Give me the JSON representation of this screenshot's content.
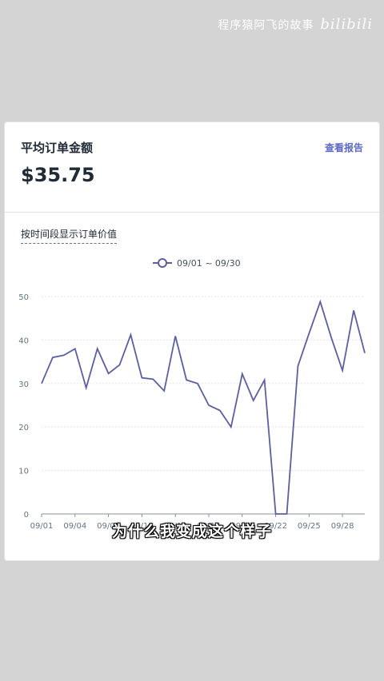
{
  "watermark": {
    "text": "程序猿阿飞的故事",
    "logo": "bilibili"
  },
  "card": {
    "title": "平均订单金额",
    "view_report": "查看报告",
    "amount": "$35.75",
    "subtitle": "按时间段显示订单价值"
  },
  "caption": "为什么我变成这个样子",
  "colors": {
    "line": "#5c5f9e",
    "accent": "#5c6ac4",
    "grid": "#dfe3e8"
  },
  "chart_data": {
    "type": "line",
    "legend": "09/01 ~ 09/30",
    "legend_position": "top-center",
    "grid": true,
    "ylim": [
      0,
      50
    ],
    "yticks": [
      0,
      10,
      20,
      30,
      40,
      50
    ],
    "xtick_labels": [
      "09/01",
      "09/04",
      "09/07",
      "09/10",
      "09/13",
      "09/16",
      "09/19",
      "09/22",
      "09/25",
      "09/28"
    ],
    "x": [
      "09/01",
      "09/02",
      "09/03",
      "09/04",
      "09/05",
      "09/06",
      "09/07",
      "09/08",
      "09/09",
      "09/10",
      "09/11",
      "09/12",
      "09/13",
      "09/14",
      "09/15",
      "09/16",
      "09/17",
      "09/18",
      "09/19",
      "09/20",
      "09/21",
      "09/22",
      "09/23",
      "09/24",
      "09/25",
      "09/26",
      "09/27",
      "09/28",
      "09/29",
      "09/30"
    ],
    "series": [
      {
        "values": [
          30,
          36,
          36.5,
          38,
          29,
          38,
          32.3,
          34.3,
          41.2,
          31.3,
          31,
          28.3,
          40.9,
          30.8,
          30,
          25,
          23.8,
          20,
          32.2,
          26.1,
          30.8,
          0,
          0,
          34,
          41.5,
          48.8,
          40.5,
          33,
          46.8,
          37
        ]
      }
    ]
  }
}
